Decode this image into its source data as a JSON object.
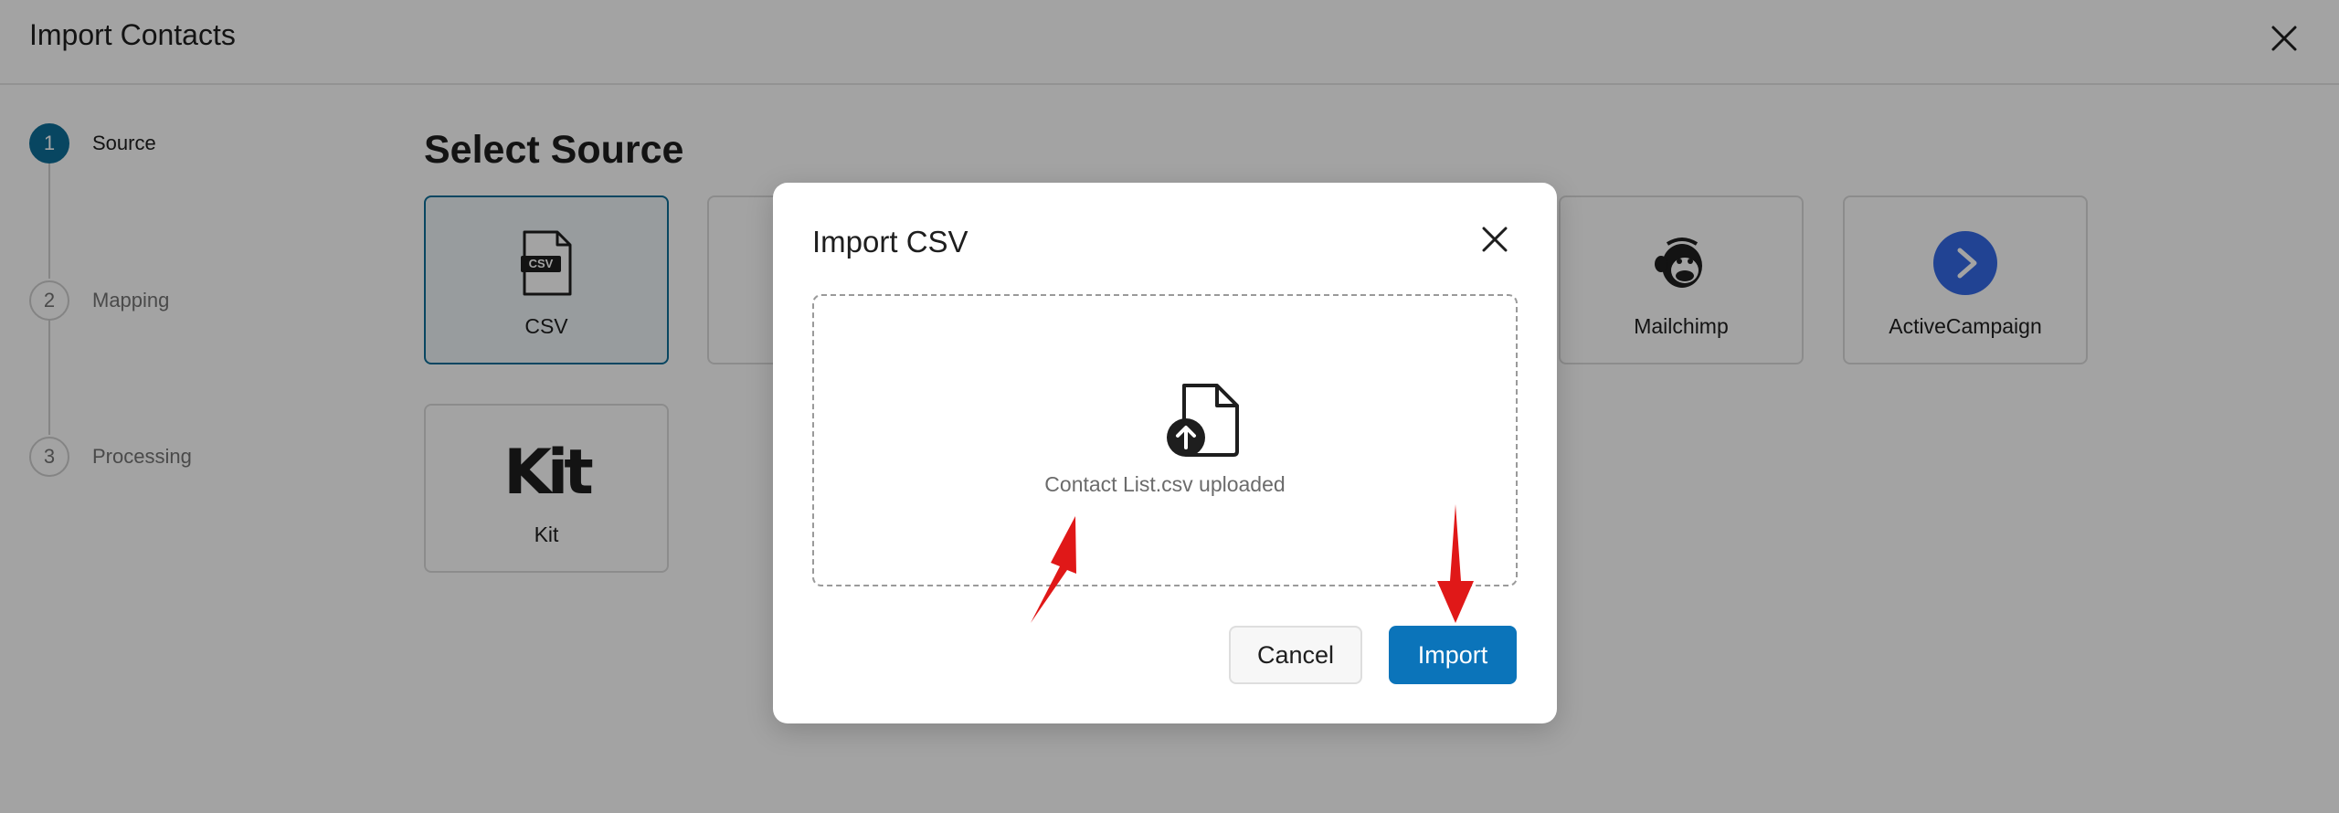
{
  "header": {
    "title": "Import Contacts",
    "close_icon": "close-icon"
  },
  "steps": [
    {
      "number": "1",
      "label": "Source",
      "state": "active"
    },
    {
      "number": "2",
      "label": "Mapping",
      "state": "pending"
    },
    {
      "number": "3",
      "label": "Processing",
      "state": "pending"
    }
  ],
  "main": {
    "section_title": "Select Source",
    "sources": [
      {
        "label": "CSV",
        "icon": "csv-file-icon",
        "selected": true
      },
      {
        "label": "",
        "icon": "",
        "selected": false
      },
      {
        "label": "Mailchimp",
        "icon": "mailchimp-icon",
        "selected": false
      },
      {
        "label": "ActiveCampaign",
        "icon": "activecampaign-icon",
        "selected": false
      },
      {
        "label": "Kit",
        "icon": "kit-logo-icon",
        "selected": false
      }
    ],
    "csv_badge": "CSV",
    "kit_logo_text": "Kit"
  },
  "modal": {
    "title": "Import CSV",
    "upload_status": "Contact List.csv uploaded",
    "cancel_label": "Cancel",
    "import_label": "Import"
  },
  "colors": {
    "accent": "#0d6e98",
    "primary_button": "#0b74ba",
    "activecampaign": "#356ae6",
    "annotation_arrow": "#e01818"
  }
}
